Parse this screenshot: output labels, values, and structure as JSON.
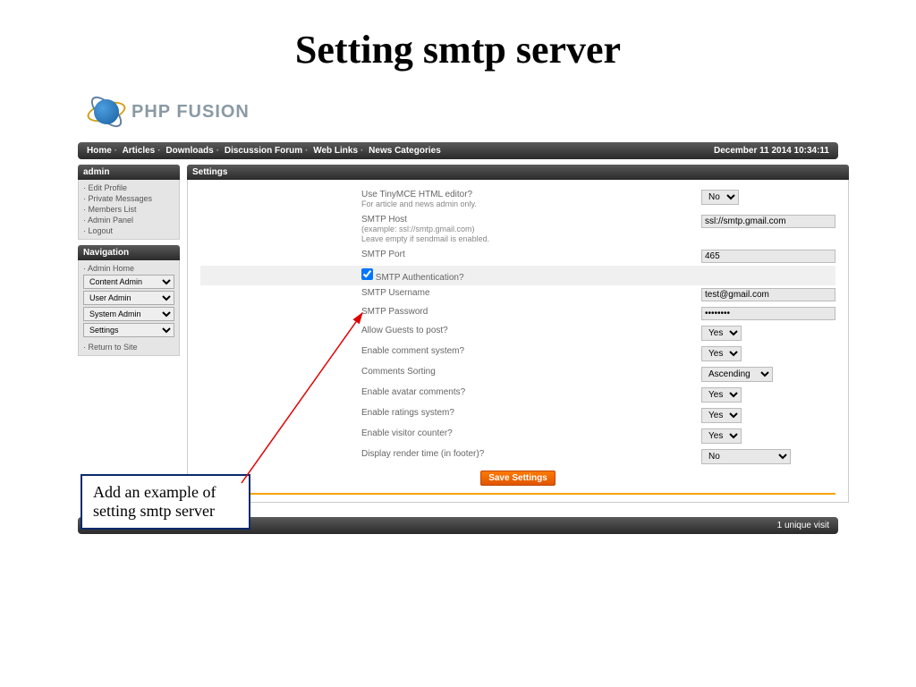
{
  "slide_title": "Setting smtp server",
  "logo_text": "PHP    FUSION",
  "topnav": {
    "items": [
      "Home",
      "Articles",
      "Downloads",
      "Discussion Forum",
      "Web Links",
      "News Categories"
    ],
    "datetime": "December 11 2014 10:34:11"
  },
  "sidebar": {
    "admin_title": "admin",
    "admin_items": [
      "Edit Profile",
      "Private Messages",
      "Members List",
      "Admin Panel",
      "Logout"
    ],
    "nav_title": "Navigation",
    "nav_home": "Admin Home",
    "nav_selects": [
      "Content Admin",
      "User Admin",
      "System Admin",
      "Settings"
    ],
    "nav_return": "Return to Site"
  },
  "main": {
    "title": "Settings",
    "rows": {
      "tinymce_label": "Use TinyMCE HTML editor?",
      "tinymce_sub": "For article and news admin only.",
      "tinymce_val": "No",
      "smtp_host_label": "SMTP Host",
      "smtp_host_sub1": "(example: ssl://smtp.gmail.com)",
      "smtp_host_sub2": "Leave empty if sendmail is enabled.",
      "smtp_host_val": "ssl://smtp.gmail.com",
      "smtp_port_label": "SMTP Port",
      "smtp_port_val": "465",
      "smtp_auth_label": "SMTP Authentication?",
      "smtp_user_label": "SMTP Username",
      "smtp_user_val": "test@gmail.com",
      "smtp_pass_label": "SMTP Password",
      "smtp_pass_val": "••••••••",
      "guests_label": "Allow Guests to post?",
      "guests_val": "Yes",
      "comments_label": "Enable comment system?",
      "comments_val": "Yes",
      "sort_label": "Comments Sorting",
      "sort_val": "Ascending",
      "avatar_label": "Enable avatar comments?",
      "avatar_val": "Yes",
      "ratings_label": "Enable ratings system?",
      "ratings_val": "Yes",
      "visitor_label": "Enable visitor counter?",
      "visitor_val": "Yes",
      "render_label": "Display render time (in footer)?",
      "render_val": "No"
    },
    "save_label": "Save Settings"
  },
  "footer": "1 unique visit",
  "annotation": "Add an example of setting smtp server"
}
